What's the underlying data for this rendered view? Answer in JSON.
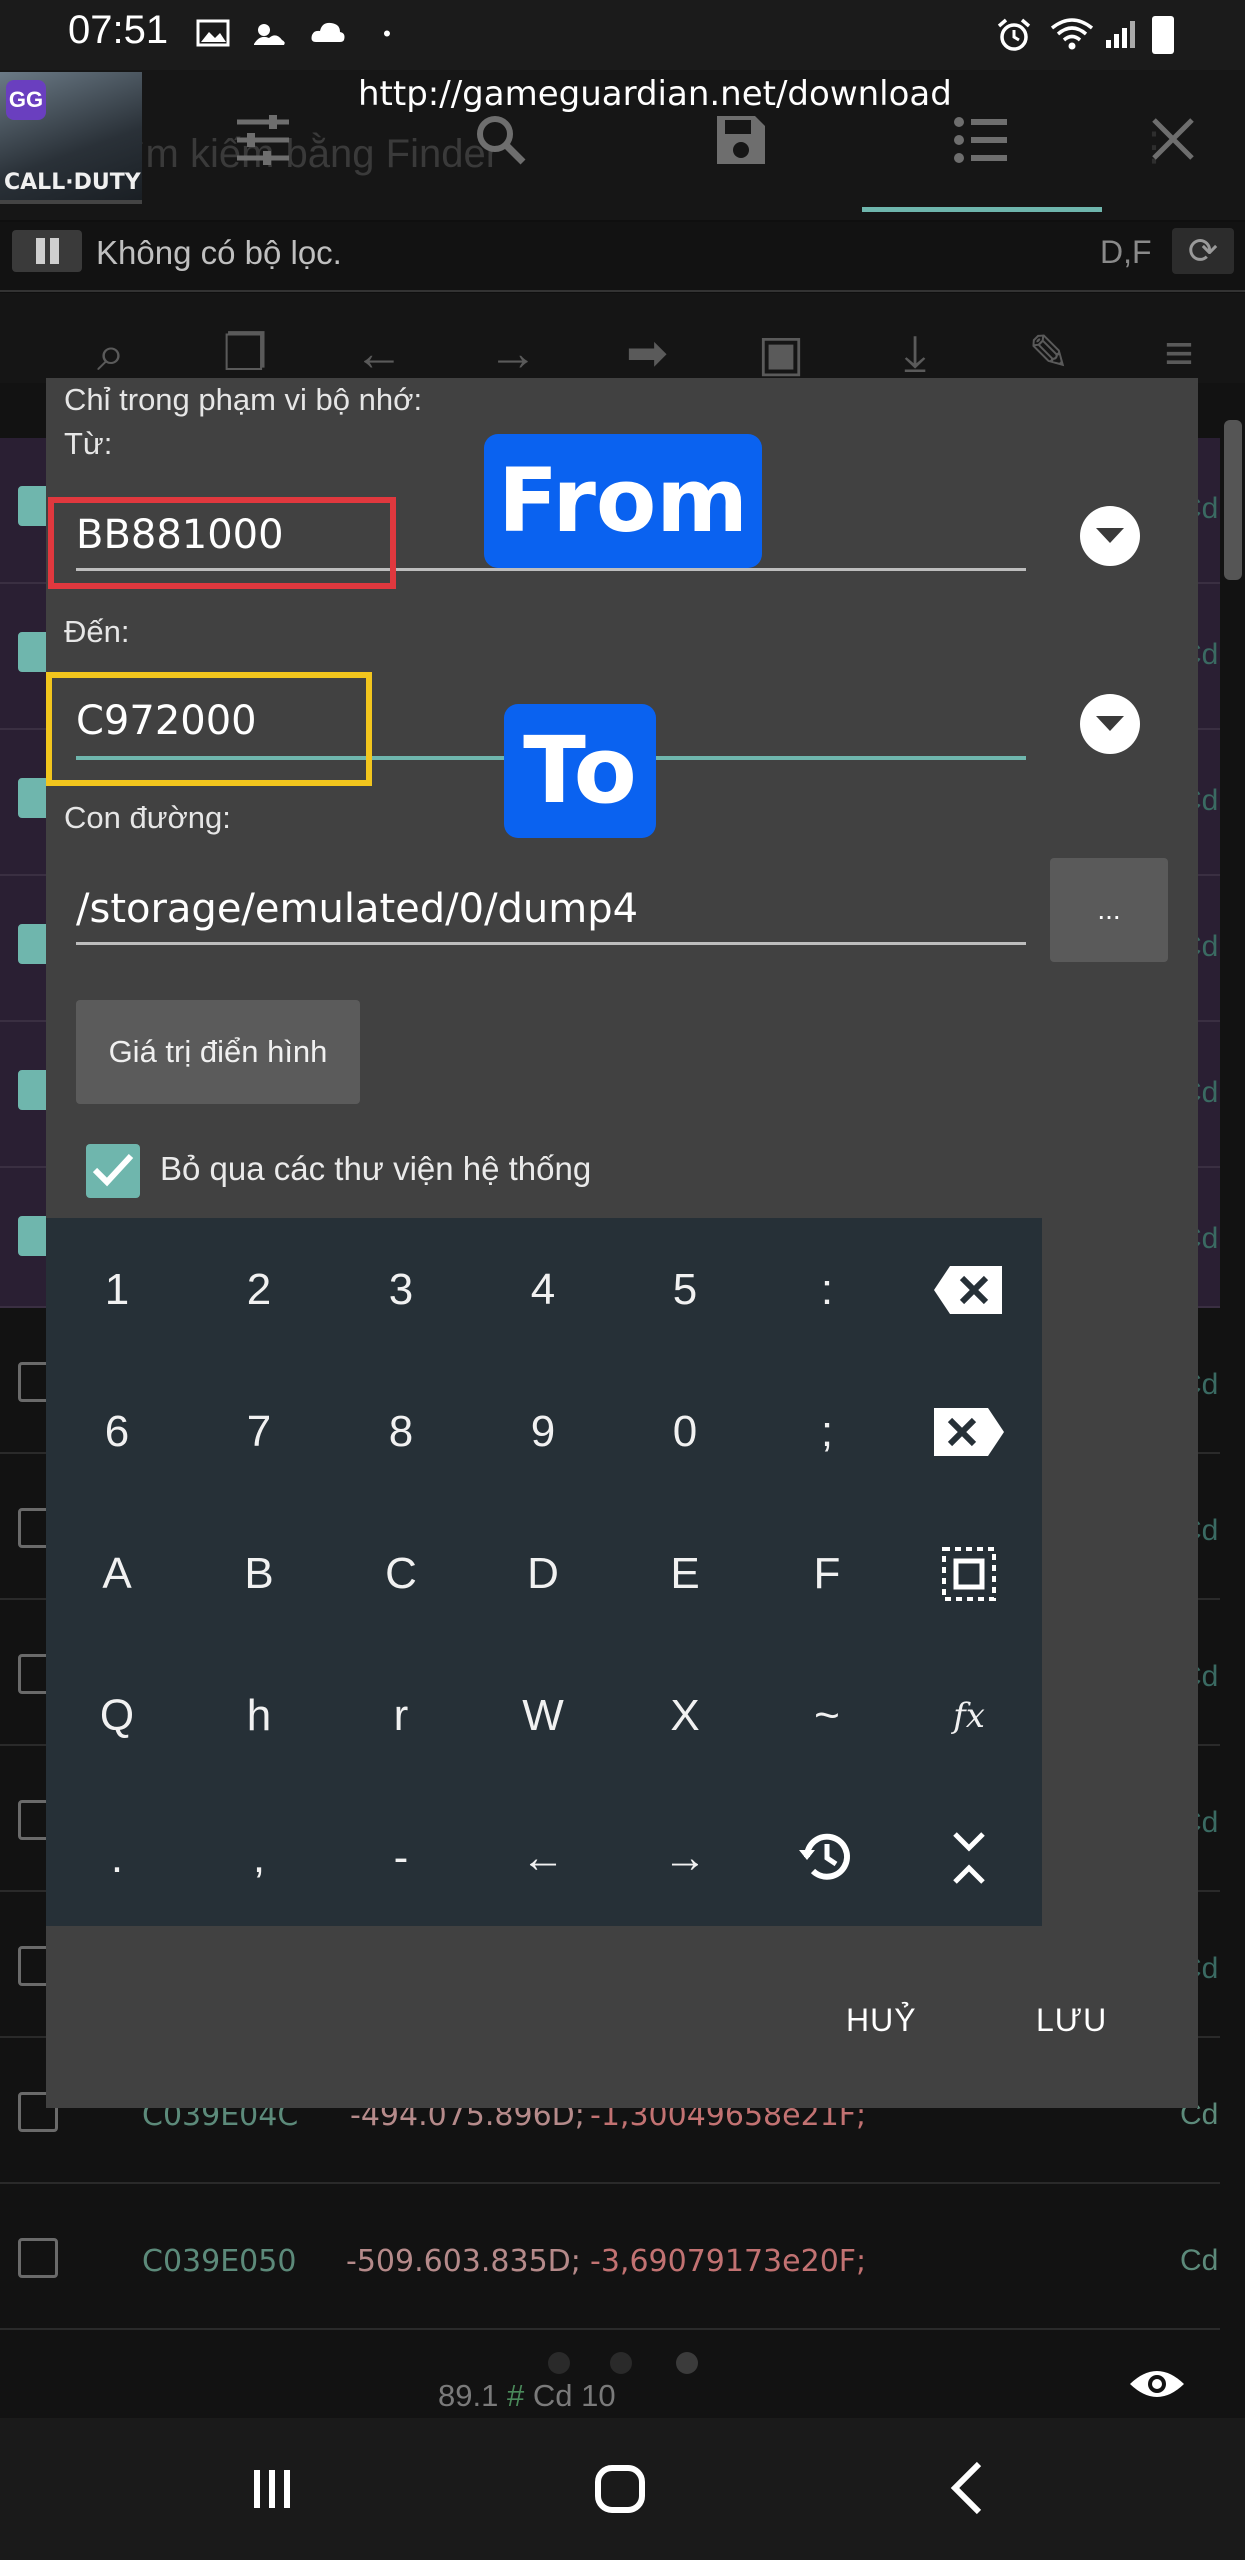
{
  "status_bar": {
    "time": "07:51"
  },
  "header": {
    "url": "http://gameguardian.net/download",
    "faded_title": "Tìm kiếm bằng Finder",
    "thumb_logo": "GG",
    "thumb_caption": "CALL·DUTY"
  },
  "filter_bar": {
    "text": "Không có bộ lọc.",
    "flags": "D,F"
  },
  "background_list": {
    "rows": [
      {
        "address": "C039E04C",
        "value1": "-494.075.896D;",
        "value2": "-1,30049658e21F;",
        "suffix": "Cd"
      },
      {
        "address": "C039E050",
        "value1": "-509.603.835D;",
        "value2": "-3,69079173e20F;",
        "suffix": "Cd"
      }
    ],
    "edge_suffix": "Cd"
  },
  "dialog": {
    "memory_range_label": "Chỉ trong phạm vi bộ nhớ:",
    "from_label": "Từ:",
    "from_value": "BB881000",
    "from_badge": "From",
    "to_label": "Đến:",
    "to_value": "C972000",
    "to_badge": "To",
    "path_label": "Con đường:",
    "path_value": "/storage/emulated/0/dump4",
    "browse_label": "...",
    "typical_button": "Giá trị điển hình",
    "skip_system_libs_label": "Bỏ qua các thư viện hệ thống",
    "skip_system_libs_checked": true,
    "cancel_button": "HUỶ",
    "save_button": "LƯU"
  },
  "keypad": {
    "rows": [
      [
        "1",
        "2",
        "3",
        "4",
        "5",
        ":",
        "backspace-icon"
      ],
      [
        "6",
        "7",
        "8",
        "9",
        "0",
        ";",
        "delete-icon"
      ],
      [
        "A",
        "B",
        "C",
        "D",
        "E",
        "F",
        "select-all-icon"
      ],
      [
        "Q",
        "h",
        "r",
        "W",
        "X",
        "~",
        "fx"
      ],
      [
        ".",
        ",",
        "-",
        "←",
        "→",
        "history-icon",
        "collapse-icon"
      ]
    ]
  },
  "bottom": {
    "status_prefix": "89.1",
    "status_hash": "#",
    "status_suffix": "Cd 10"
  },
  "colors": {
    "accent": "#6fb6ad",
    "dialog_bg": "#414141",
    "keypad_bg": "#263037",
    "badge_blue": "#0a62f0",
    "highlight_red": "#e0383e",
    "highlight_yellow": "#f2c51d"
  }
}
